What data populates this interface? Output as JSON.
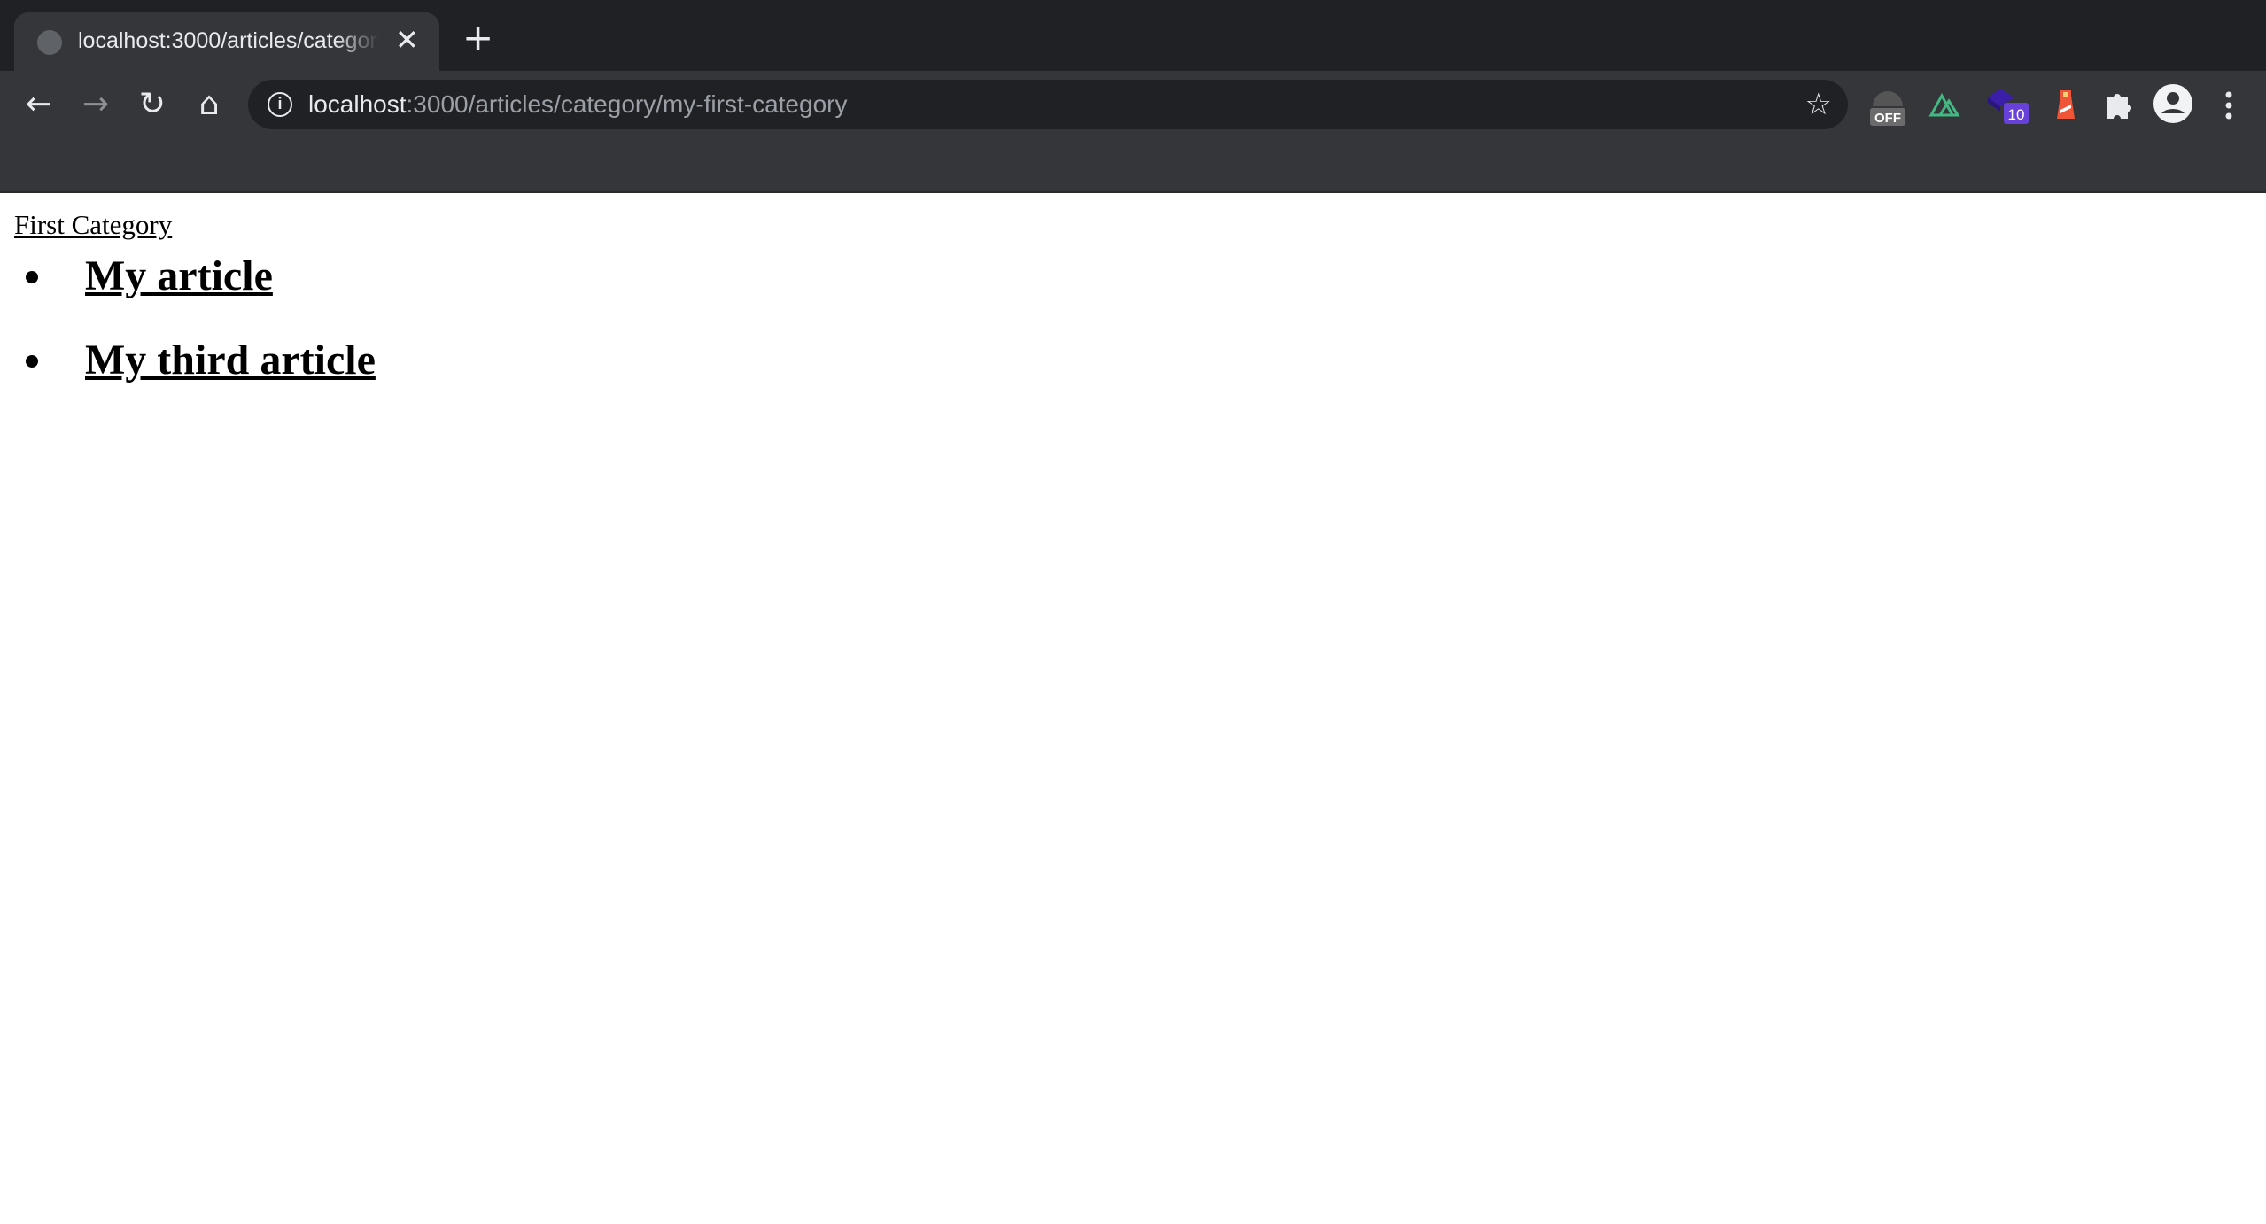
{
  "browser": {
    "tab": {
      "title": "localhost:3000/articles/category/my-first-category",
      "close": "✕",
      "favicon": "globe-icon"
    },
    "new_tab": "+",
    "nav": {
      "back": "←",
      "forward": "→",
      "reload": "↻",
      "home": "⌂"
    },
    "address": {
      "host": "localhost",
      "rest": ":3000/articles/category/my-first-category",
      "bookmark": "☆"
    },
    "extensions": [
      {
        "name": "off-extension",
        "badge": "OFF"
      },
      {
        "name": "vue-devtools"
      },
      {
        "name": "stack-extension",
        "badge": "10",
        "badge_color": "#6741d9"
      },
      {
        "name": "lighthouse"
      },
      {
        "name": "extensions-puzzle"
      }
    ]
  },
  "page": {
    "category_link": "First Category",
    "articles": [
      "My article",
      "My third article"
    ]
  }
}
